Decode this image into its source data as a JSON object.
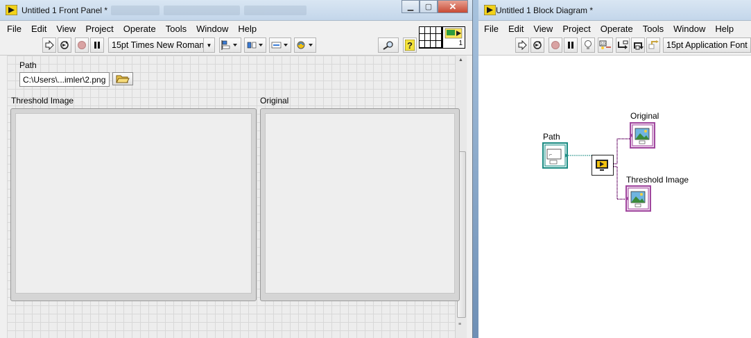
{
  "front_panel": {
    "title": "Untitled 1 Front Panel *",
    "menu": [
      "File",
      "Edit",
      "View",
      "Project",
      "Operate",
      "Tools",
      "Window",
      "Help"
    ],
    "font_selector": "15pt Times New Roman",
    "controls": {
      "path_label": "Path",
      "path_value": "C:\\Users\\...imler\\2.png",
      "threshold_label": "Threshold Image",
      "original_label": "Original"
    },
    "connector_count": "1"
  },
  "block_diagram": {
    "title": "Untitled 1 Block Diagram *",
    "menu": [
      "File",
      "Edit",
      "View",
      "Project",
      "Operate",
      "Tools",
      "Window",
      "Help"
    ],
    "font_selector": "15pt Application Font",
    "nodes": {
      "path_label": "Path",
      "original_label": "Original",
      "threshold_label": "Threshold Image"
    }
  },
  "colors": {
    "wire_path": "#1e8c84",
    "wire_image": "#7b2c7b",
    "path_terminal": "#1e8c84",
    "image_terminal": "#a0479e"
  }
}
